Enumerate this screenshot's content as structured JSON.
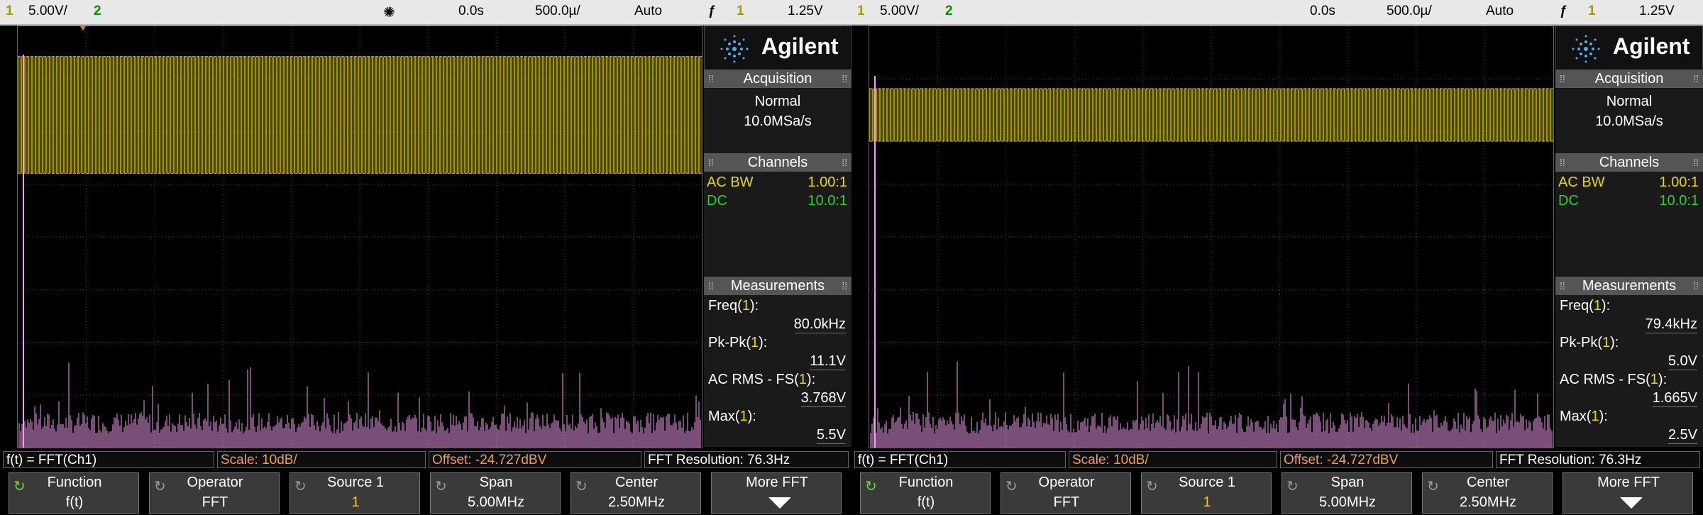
{
  "colors": {
    "ch1": "#d8c800",
    "fft": "#f29cf2",
    "ch2": "#2fd02f",
    "accent_orange": "#e8a060"
  },
  "screens": [
    {
      "topbar": {
        "ch1_num": "1",
        "ch1_scale": "5.00V/",
        "ch2_num": "2",
        "time_offset": "0.0s",
        "time_scale": "500.0µ/",
        "trigger_mode": "Auto",
        "trig_icon": "ƒ",
        "trig_src": "1",
        "trig_level": "1.25V"
      },
      "sidebar": {
        "brand": "Agilent",
        "acquisition": {
          "title": "Acquisition",
          "mode": "Normal",
          "rate": "10.0MSa/s"
        },
        "channels": {
          "title": "Channels",
          "rows": [
            {
              "label": "AC BW",
              "value": "1.00:1"
            },
            {
              "label": "DC",
              "value": "10.0:1"
            }
          ]
        },
        "measurements": {
          "title": "Measurements",
          "items": [
            {
              "label_pre": "Freq(",
              "src": "1",
              "label_post": "):",
              "value": "80.0kHz"
            },
            {
              "label_pre": "Pk-Pk(",
              "src": "1",
              "label_post": "):",
              "value": "11.1V"
            },
            {
              "label_pre": "AC RMS - FS(",
              "src": "1",
              "label_post": "):",
              "value": "3.768V"
            },
            {
              "label_pre": "Max(",
              "src": "1",
              "label_post": "):",
              "value": "5.5V"
            }
          ]
        }
      },
      "fft_bar": {
        "func": "f(t) = FFT(Ch1)",
        "scale": "Scale: 10dB/",
        "offset": "Offset: -24.727dBV",
        "resolution": "FFT Resolution: 76.3Hz"
      },
      "softkeys": [
        {
          "label": "Function",
          "value": "f(t)"
        },
        {
          "label": "Operator",
          "value": "FFT"
        },
        {
          "label": "Source 1",
          "value": "1"
        },
        {
          "label": "Span",
          "value": "5.00MHz"
        },
        {
          "label": "Center",
          "value": "2.50MHz"
        },
        {
          "label": "More FFT",
          "value": ""
        }
      ],
      "waveform": {
        "ch1_amplitude_vpp": 11.1,
        "ch1_freq_khz": 80.0
      }
    },
    {
      "topbar": {
        "ch1_num": "1",
        "ch1_scale": "5.00V/",
        "ch2_num": "2",
        "time_offset": "0.0s",
        "time_scale": "500.0µ/",
        "trigger_mode": "Auto",
        "trig_icon": "ƒ",
        "trig_src": "1",
        "trig_level": "1.25V"
      },
      "sidebar": {
        "brand": "Agilent",
        "acquisition": {
          "title": "Acquisition",
          "mode": "Normal",
          "rate": "10.0MSa/s"
        },
        "channels": {
          "title": "Channels",
          "rows": [
            {
              "label": "AC BW",
              "value": "1.00:1"
            },
            {
              "label": "DC",
              "value": "10.0:1"
            }
          ]
        },
        "measurements": {
          "title": "Measurements",
          "items": [
            {
              "label_pre": "Freq(",
              "src": "1",
              "label_post": "):",
              "value": "79.4kHz"
            },
            {
              "label_pre": "Pk-Pk(",
              "src": "1",
              "label_post": "):",
              "value": "5.0V"
            },
            {
              "label_pre": "AC RMS - FS(",
              "src": "1",
              "label_post": "):",
              "value": "1.665V"
            },
            {
              "label_pre": "Max(",
              "src": "1",
              "label_post": "):",
              "value": "2.5V"
            }
          ]
        }
      },
      "fft_bar": {
        "func": "f(t) = FFT(Ch1)",
        "scale": "Scale: 10dB/",
        "offset": "Offset: -24.727dBV",
        "resolution": "FFT Resolution: 76.3Hz"
      },
      "softkeys": [
        {
          "label": "Function",
          "value": "f(t)"
        },
        {
          "label": "Operator",
          "value": "FFT"
        },
        {
          "label": "Source 1",
          "value": "1"
        },
        {
          "label": "Span",
          "value": "5.00MHz"
        },
        {
          "label": "Center",
          "value": "2.50MHz"
        },
        {
          "label": "More FFT",
          "value": ""
        }
      ],
      "waveform": {
        "ch1_amplitude_vpp": 5.0,
        "ch1_freq_khz": 79.4
      }
    }
  ]
}
